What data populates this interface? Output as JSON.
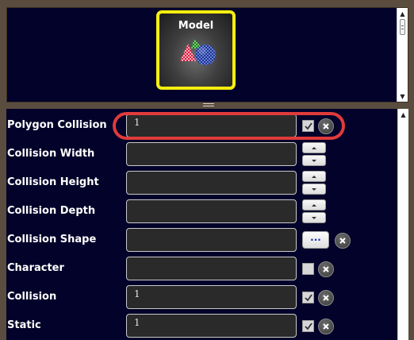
{
  "model_tile": {
    "title": "Model",
    "icon": "model-primitives-icon"
  },
  "properties": [
    {
      "label": "Polygon Collision",
      "value": "1",
      "control": "checkbox",
      "checked": true,
      "highlighted": true
    },
    {
      "label": "Collision Width",
      "value": "",
      "control": "stepper"
    },
    {
      "label": "Collision Height",
      "value": "",
      "control": "stepper"
    },
    {
      "label": "Collision Depth",
      "value": "",
      "control": "stepper"
    },
    {
      "label": "Collision Shape",
      "value": "",
      "control": "browse",
      "browse_label": "..."
    },
    {
      "label": "Character",
      "value": "",
      "control": "checkbox",
      "checked": false
    },
    {
      "label": "Collision",
      "value": "1",
      "control": "checkbox",
      "checked": true
    },
    {
      "label": "Static",
      "value": "1",
      "control": "checkbox",
      "checked": true
    }
  ],
  "colors": {
    "panel_bg": "#02022a",
    "frame": "#5a4d3f",
    "tile_border": "#f7ee10",
    "highlight": "#e03b3b",
    "browse_text": "#1a2fb8"
  }
}
